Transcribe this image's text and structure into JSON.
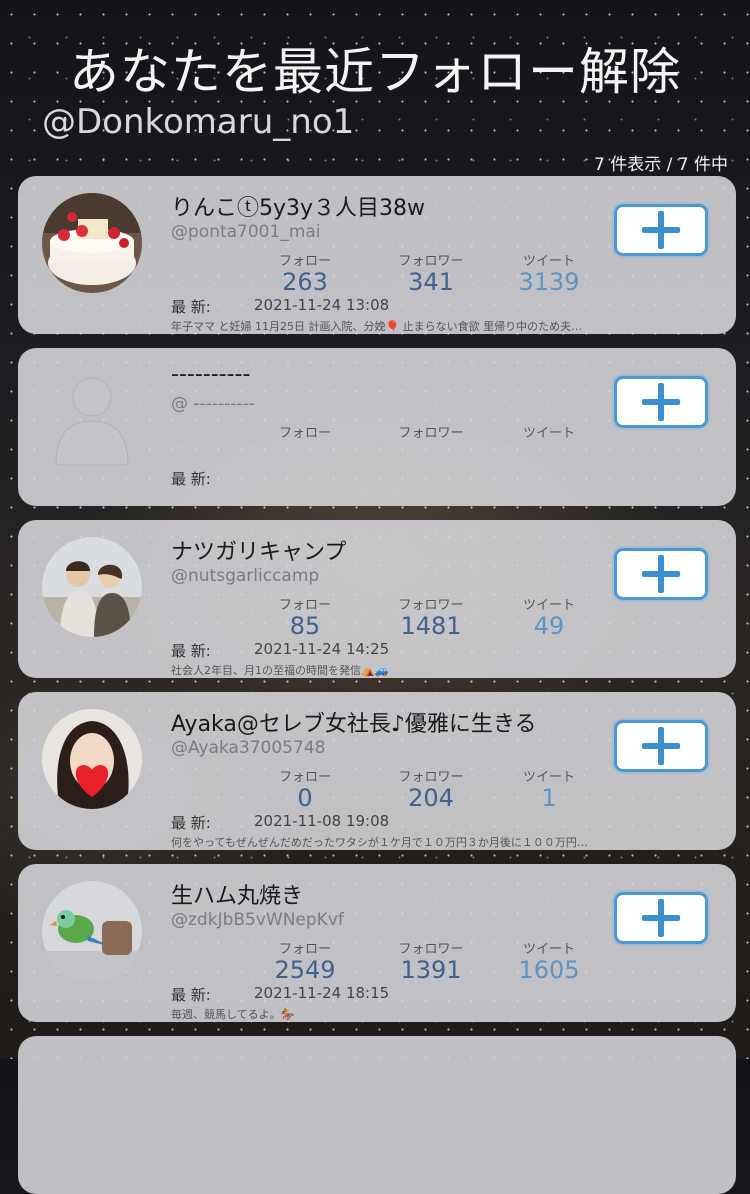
{
  "header": {
    "title": "あなたを最近フォロー解除",
    "handle": "@Donkomaru_no1",
    "count": "7 件表示 / 7 件中"
  },
  "labels": {
    "follow": "フォロー",
    "followers": "フォロワー",
    "tweets": "ツイート",
    "latest": "最 新:"
  },
  "users": [
    {
      "name": "りんこⓣ5y3y３人目38w",
      "id": "@ponta7001_mai",
      "follow": "263",
      "followers": "341",
      "tweets": "3139",
      "latest": "2021-11-24 13:08",
      "bio": "年子ママ と妊婦 11月25日 計画入院、分娩🎈 止まらない食欲 里帰り中のため夫…",
      "avatar_icon": "cake-photo"
    },
    {
      "name": "----------",
      "id": "@ ----------",
      "follow": "",
      "followers": "",
      "tweets": "",
      "latest": "",
      "bio": "",
      "avatar_icon": "default-person-silhouette"
    },
    {
      "name": "ナツガリキャンプ",
      "id": "@nutsgarliccamp",
      "follow": "85",
      "followers": "1481",
      "tweets": "49",
      "latest": "2021-11-24 14:25",
      "bio": "社会人2年目、月1の至福の時間を発信⛺🚙",
      "avatar_icon": "two-people-photo"
    },
    {
      "name": "Ayaka@セレブ女社長♪優雅に生きる",
      "id": "@Ayaka37005748",
      "follow": "0",
      "followers": "204",
      "tweets": "1",
      "latest": "2021-11-08 19:08",
      "bio": "何をやってもぜんぜんだめだったワタシが１ケ月で１０万円３か月後に１００万円…",
      "avatar_icon": "woman-heart-photo"
    },
    {
      "name": "生ハム丸焼き",
      "id": "@zdkJbB5vWNepKvf",
      "follow": "2549",
      "followers": "1391",
      "tweets": "1605",
      "latest": "2021-11-24 18:15",
      "bio": "毎週、競馬してるよ。🏇",
      "avatar_icon": "parrot-photo"
    }
  ],
  "colors": {
    "accent": "#4c98d5",
    "stat_value": "#3f618d",
    "tweet_value": "#5a95c6"
  }
}
